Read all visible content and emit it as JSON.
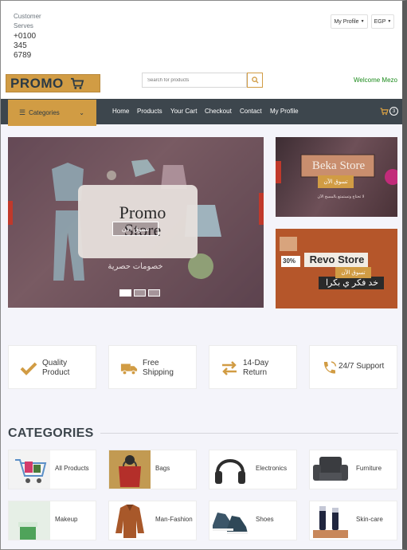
{
  "topbar": {
    "customer_service_line1": "Customer",
    "customer_service_line2": "Serves",
    "phone_parts": [
      "+0100",
      "345",
      "6789"
    ],
    "profile_dropdown": "My Profile",
    "currency_dropdown": "EGP"
  },
  "header": {
    "logo_text": "PROMO",
    "search_placeholder": "Search for products",
    "welcome": "Welcome Mezo"
  },
  "nav": {
    "categories_label": "Categories",
    "links": [
      "Home",
      "Products",
      "Your Cart",
      "Checkout",
      "Contact",
      "My Profile"
    ],
    "cart_count": "3"
  },
  "hero": {
    "title_line1": "Promo",
    "title_line2": "Store",
    "shop_button": "تسوق الآن",
    "tagline": "خصومات حصرية"
  },
  "side_ads": [
    {
      "store": "Beka Store",
      "button": "تسوق الآن",
      "caption": "لا تحتاج وتستمتع بالمسح الآن"
    },
    {
      "store": "Revo Store",
      "button": "تسوق الآن",
      "discount": "30%",
      "caption": "خد فكر ي بكرا"
    }
  ],
  "features": [
    {
      "line1": "Quality",
      "line2": "Product",
      "icon": "check-icon"
    },
    {
      "line1": "Free",
      "line2": "Shipping",
      "icon": "truck-icon"
    },
    {
      "line1": "14-Day",
      "line2": "Return",
      "icon": "exchange-icon"
    },
    {
      "line1": "24/7 Support",
      "line2": "",
      "icon": "phone-icon"
    }
  ],
  "categories": {
    "heading": "CATEGORIES",
    "items": [
      "All Products",
      "Bags",
      "Electronics",
      "Furniture",
      "Makeup",
      "Man-Fashion",
      "Shoes",
      "Skin-care"
    ]
  },
  "colors": {
    "accent": "#d19c44",
    "navbar": "#3d464d",
    "welcome": "#1a8a1a"
  }
}
